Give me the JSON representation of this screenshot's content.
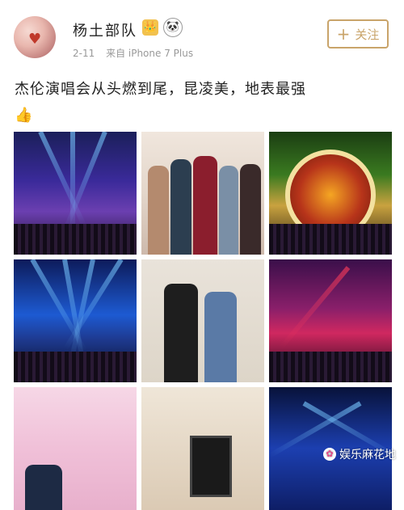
{
  "user": {
    "name": "杨土部队",
    "badge_crown": "👑",
    "badge_panda": "🐼",
    "post_date": "2-11",
    "source": "来自 iPhone 7 Plus"
  },
  "follow_button": {
    "icon": "plus-icon",
    "label": "关注",
    "color": "#c9a46a"
  },
  "post": {
    "text": "杰伦演唱会从头燃到尾，昆凌美，地表最强",
    "emoji": "👍"
  },
  "photos": [
    {
      "subject": "concert-stage-lights"
    },
    {
      "subject": "group-photo"
    },
    {
      "subject": "stage-wheel"
    },
    {
      "subject": "concert-blue-lights"
    },
    {
      "subject": "couple-photo"
    },
    {
      "subject": "stage-red-lights"
    },
    {
      "subject": "singer-guitar"
    },
    {
      "subject": "framed-portrait"
    },
    {
      "subject": "concert-blue-stage"
    }
  ],
  "watermark": {
    "icon": "flower-icon",
    "text": "娱乐麻花地"
  }
}
